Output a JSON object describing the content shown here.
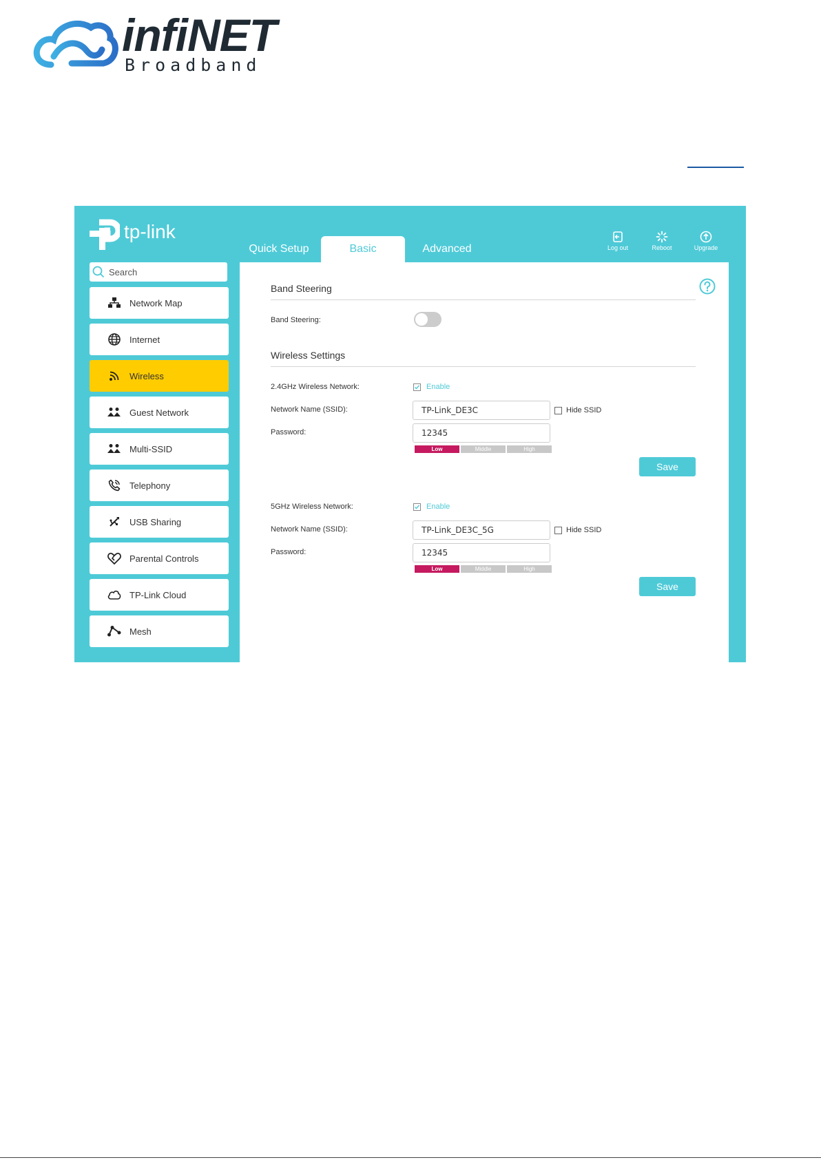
{
  "brand": {
    "name": "infiNET",
    "subtitle": "Broadband"
  },
  "router": {
    "logo_text": "tp-link",
    "tabs": [
      {
        "label": "Quick Setup"
      },
      {
        "label": "Basic"
      },
      {
        "label": "Advanced"
      }
    ],
    "actions": [
      {
        "label": "Log out",
        "icon": "logout-icon"
      },
      {
        "label": "Reboot",
        "icon": "reboot-icon"
      },
      {
        "label": "Upgrade",
        "icon": "upgrade-icon"
      }
    ],
    "search": {
      "placeholder": "Search"
    },
    "sidebar": [
      {
        "label": "Network Map",
        "icon": "network-map-icon"
      },
      {
        "label": "Internet",
        "icon": "globe-icon"
      },
      {
        "label": "Wireless",
        "icon": "wifi-icon"
      },
      {
        "label": "Guest Network",
        "icon": "guest-icon"
      },
      {
        "label": "Multi-SSID",
        "icon": "multi-ssid-icon"
      },
      {
        "label": "Telephony",
        "icon": "phone-icon"
      },
      {
        "label": "USB Sharing",
        "icon": "usb-icon"
      },
      {
        "label": "Parental Controls",
        "icon": "heart-icon"
      },
      {
        "label": "TP-Link Cloud",
        "icon": "cloud-icon"
      },
      {
        "label": "Mesh",
        "icon": "mesh-icon"
      }
    ],
    "band_steering": {
      "title": "Band Steering",
      "label": "Band Steering:",
      "enabled": false
    },
    "wireless_settings": {
      "title": "Wireless Settings",
      "network_name_label": "Network Name (SSID):",
      "password_label": "Password:",
      "hide_ssid_label": "Hide SSID",
      "enable_label": "Enable",
      "save_label": "Save",
      "strength_levels": [
        "Low",
        "Middle",
        "High"
      ],
      "band_24": {
        "label": "2.4GHz Wireless Network:",
        "ssid": "TP-Link_DE3C",
        "password": "12345",
        "strength": "Low"
      },
      "band_5": {
        "label": "5GHz Wireless Network:",
        "ssid": "TP-Link_DE3C_5G",
        "password": "12345",
        "strength": "Low"
      }
    }
  },
  "colors": {
    "teal": "#4ecad7",
    "active_nav": "#ffcc00",
    "strength_low": "#c51a5f",
    "brand_blue": "#3c8fd6"
  }
}
